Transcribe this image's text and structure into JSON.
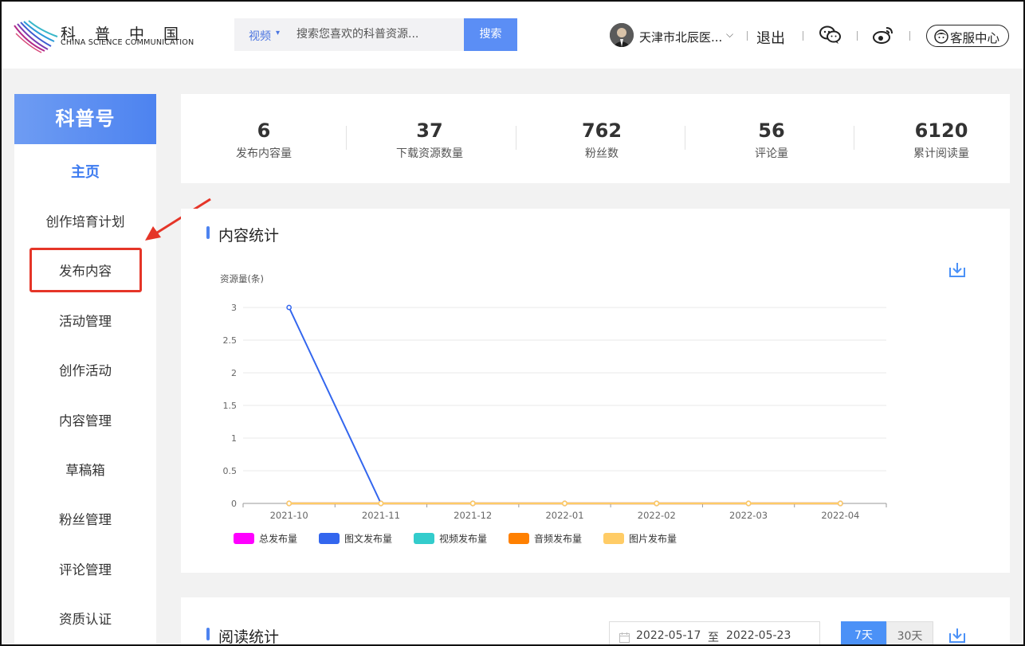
{
  "header": {
    "logo_cn": "科普中国",
    "logo_en": "CHINA SCIENCE COMMUNICATION",
    "search": {
      "category": "视频",
      "placeholder": "搜索您喜欢的科普资源...",
      "button": "搜索"
    },
    "user_name": "天津市北辰医...",
    "logout": "退出",
    "service": "客服中心",
    "icons": {
      "wechat": "wechat-icon",
      "weibo": "weibo-icon",
      "service": "headset-user-icon"
    }
  },
  "sidebar": {
    "title": "科普号",
    "items": [
      {
        "label": "主页",
        "active": true
      },
      {
        "label": "创作培育计划"
      },
      {
        "label": "发布内容",
        "highlighted": true
      },
      {
        "label": "活动管理"
      },
      {
        "label": "创作活动"
      },
      {
        "label": "内容管理"
      },
      {
        "label": "草稿箱"
      },
      {
        "label": "粉丝管理"
      },
      {
        "label": "评论管理"
      },
      {
        "label": "资质认证"
      }
    ]
  },
  "stats": [
    {
      "value": "6",
      "label": "发布内容量"
    },
    {
      "value": "37",
      "label": "下载资源数量"
    },
    {
      "value": "762",
      "label": "粉丝数"
    },
    {
      "value": "56",
      "label": "评论量"
    },
    {
      "value": "6120",
      "label": "累计阅读量"
    }
  ],
  "content_stats": {
    "title": "内容统计",
    "download_icon": "download-icon"
  },
  "chart_data": {
    "type": "line",
    "title": "",
    "ylabel": "资源量(条)",
    "xlabel": "",
    "categories": [
      "2021-10",
      "2021-11",
      "2021-12",
      "2022-01",
      "2022-02",
      "2022-03",
      "2022-04"
    ],
    "ylim": [
      0,
      3
    ],
    "yticks": [
      "0",
      "0.5",
      "1",
      "1.5",
      "2",
      "2.5",
      "3"
    ],
    "grid": true,
    "legend_position": "bottom-left",
    "series": [
      {
        "name": "总发布量",
        "color": "#ff00ff",
        "values": [
          0,
          0,
          0,
          0,
          0,
          0,
          0
        ]
      },
      {
        "name": "图文发布量",
        "color": "#3366ee",
        "values": [
          3,
          0,
          0,
          0,
          0,
          0,
          0
        ]
      },
      {
        "name": "视频发布量",
        "color": "#33cccc",
        "values": [
          0,
          0,
          0,
          0,
          0,
          0,
          0
        ]
      },
      {
        "name": "音频发布量",
        "color": "#ff8000",
        "values": [
          0,
          0,
          0,
          0,
          0,
          0,
          0
        ]
      },
      {
        "name": "图片发布量",
        "color": "#ffcc66",
        "values": [
          0,
          0,
          0,
          0,
          0,
          0,
          0
        ]
      }
    ]
  },
  "reading_stats": {
    "title": "阅读统计",
    "date_start": "2022-05-17",
    "date_separator": "至",
    "date_end": "2022-05-23",
    "range_buttons": [
      "7天",
      "30天"
    ],
    "active_range": "7天"
  },
  "colors": {
    "accent": "#4d83f0",
    "highlight": "#e53528"
  }
}
